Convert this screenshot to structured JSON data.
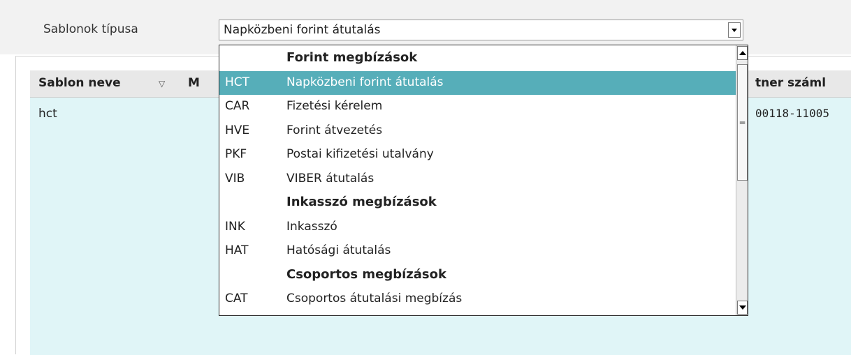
{
  "filter": {
    "label": "Sablonok típusa",
    "selected_value": "Napközbeni forint átutalás"
  },
  "grid": {
    "columns": [
      {
        "label": "Sablon neve",
        "sortable": true
      },
      {
        "label": "M"
      },
      {
        "label": "tner száml"
      }
    ],
    "rows": [
      {
        "name": "hct",
        "account": "00118-11005"
      }
    ]
  },
  "dropdown": {
    "rows": [
      {
        "type": "group",
        "code": "",
        "label": "Forint megbízások"
      },
      {
        "type": "option",
        "code": "HCT",
        "label": "Napközbeni forint átutalás",
        "selected": true
      },
      {
        "type": "option",
        "code": "CAR",
        "label": "Fizetési kérelem"
      },
      {
        "type": "option",
        "code": "HVE",
        "label": "Forint átvezetés"
      },
      {
        "type": "option",
        "code": "PKF",
        "label": "Postai kifizetési utalvány"
      },
      {
        "type": "option",
        "code": "VIB",
        "label": "VIBER átutalás"
      },
      {
        "type": "group",
        "code": "",
        "label": "Inkasszó megbízások"
      },
      {
        "type": "option",
        "code": "INK",
        "label": "Inkasszó"
      },
      {
        "type": "option",
        "code": "HAT",
        "label": "Hatósági átutalás"
      },
      {
        "type": "group",
        "code": "",
        "label": "Csoportos megbízások"
      },
      {
        "type": "option",
        "code": "CAT",
        "label": "Csoportos átutalási megbízás"
      }
    ]
  },
  "colors": {
    "selection": "#56aeb9",
    "grid_background": "#e0f5f7"
  }
}
